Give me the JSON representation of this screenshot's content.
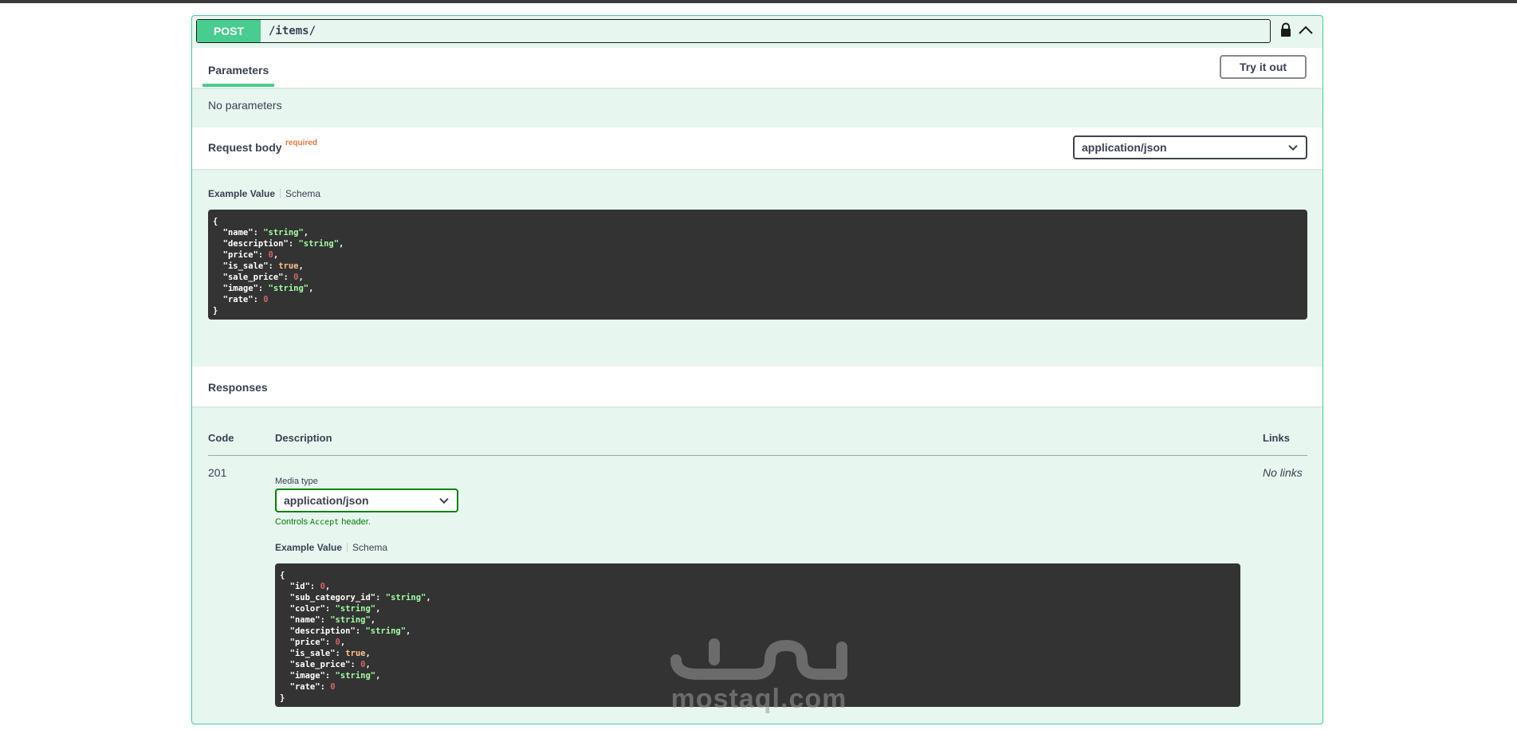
{
  "operation": {
    "method": "POST",
    "path": "/items/"
  },
  "parameters": {
    "tab_label": "Parameters",
    "try_button": "Try it out",
    "empty_text": "No parameters"
  },
  "request_body": {
    "title": "Request body",
    "required_label": "required",
    "content_type": "application/json",
    "example_tab": "Example Value",
    "schema_tab": "Schema",
    "example_lines": [
      {
        "t": "{"
      },
      {
        "k": "name",
        "v": "\"string\"",
        "c": "s",
        "comma": true
      },
      {
        "k": "description",
        "v": "\"string\"",
        "c": "s",
        "comma": true
      },
      {
        "k": "price",
        "v": "0",
        "c": "n",
        "comma": true
      },
      {
        "k": "is_sale",
        "v": "true",
        "c": "b",
        "comma": true
      },
      {
        "k": "sale_price",
        "v": "0",
        "c": "n",
        "comma": true
      },
      {
        "k": "image",
        "v": "\"string\"",
        "c": "s",
        "comma": true
      },
      {
        "k": "rate",
        "v": "0",
        "c": "n",
        "comma": false
      },
      {
        "t": "}"
      }
    ]
  },
  "responses": {
    "title": "Responses",
    "col_code": "Code",
    "col_description": "Description",
    "col_links": "Links",
    "rows": [
      {
        "code": "201",
        "links": "No links",
        "media_type_label": "Media type",
        "media_type": "application/json",
        "controls_prefix": "Controls ",
        "controls_code": "Accept",
        "controls_suffix": " header.",
        "example_tab": "Example Value",
        "schema_tab": "Schema",
        "example_lines": [
          {
            "t": "{"
          },
          {
            "k": "id",
            "v": "0",
            "c": "n",
            "comma": true
          },
          {
            "k": "sub_category_id",
            "v": "\"string\"",
            "c": "s",
            "comma": true
          },
          {
            "k": "color",
            "v": "\"string\"",
            "c": "s",
            "comma": true
          },
          {
            "k": "name",
            "v": "\"string\"",
            "c": "s",
            "comma": true
          },
          {
            "k": "description",
            "v": "\"string\"",
            "c": "s",
            "comma": true
          },
          {
            "k": "price",
            "v": "0",
            "c": "n",
            "comma": true
          },
          {
            "k": "is_sale",
            "v": "true",
            "c": "b",
            "comma": true
          },
          {
            "k": "sale_price",
            "v": "0",
            "c": "n",
            "comma": true
          },
          {
            "k": "image",
            "v": "\"string\"",
            "c": "s",
            "comma": true
          },
          {
            "k": "rate",
            "v": "0",
            "c": "n",
            "comma": false
          },
          {
            "t": "}"
          }
        ]
      }
    ]
  },
  "watermark": {
    "text": "mostaql.com"
  },
  "icons": {
    "lock": "lock-icon",
    "collapse": "chevron-up-icon",
    "dropdown": "chevron-down-icon"
  },
  "colors": {
    "post_accent": "#49cc90",
    "post_background": "#e8f6f0",
    "code_background": "#333333",
    "required": "#e07a3e",
    "accept_green": "#008000"
  }
}
